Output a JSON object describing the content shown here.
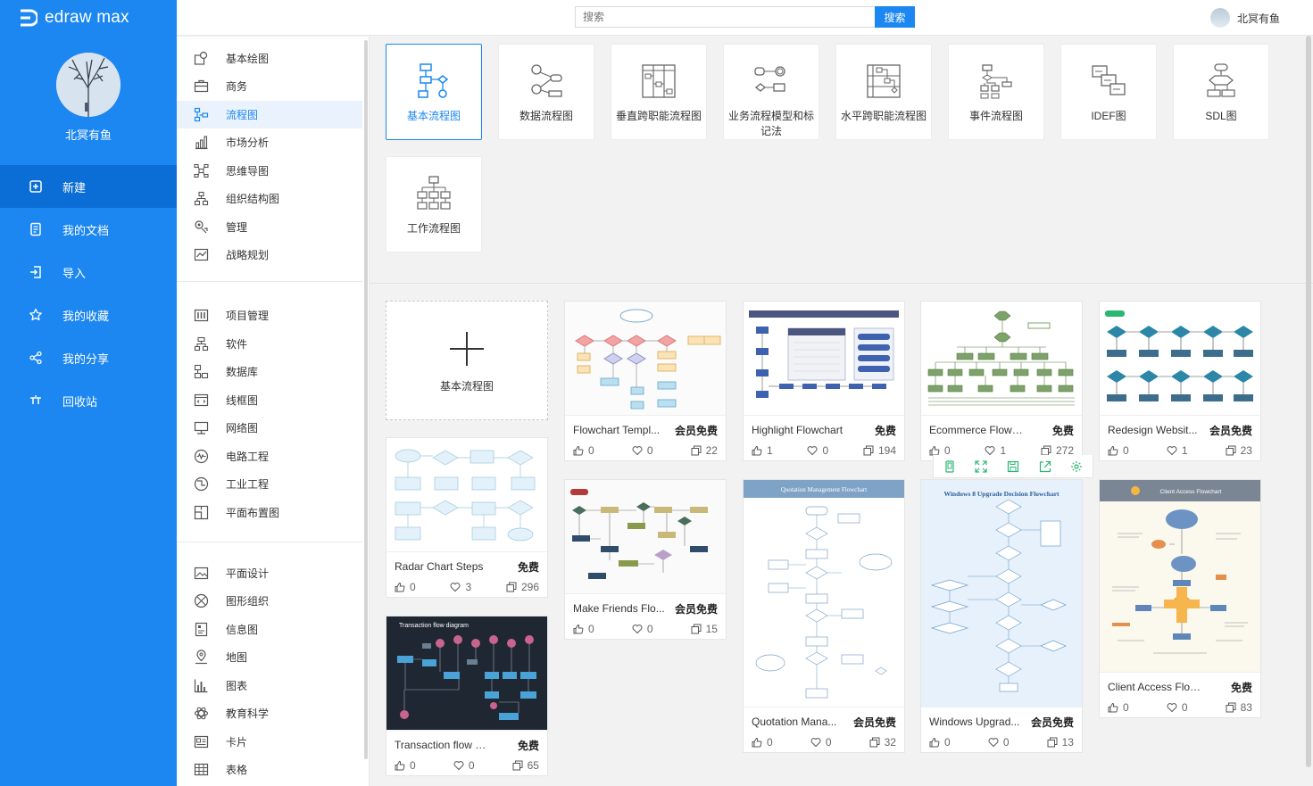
{
  "app": {
    "logo_text": "edraw max"
  },
  "user": {
    "name": "北冥有鱼"
  },
  "nav": [
    {
      "label": "新建",
      "icon": "new-file-icon",
      "active": true
    },
    {
      "label": "我的文档",
      "icon": "documents-icon"
    },
    {
      "label": "导入",
      "icon": "import-icon"
    },
    {
      "label": "我的收藏",
      "icon": "star-icon"
    },
    {
      "label": "我的分享",
      "icon": "share-icon"
    },
    {
      "label": "回收站",
      "icon": "trash-icon"
    }
  ],
  "search": {
    "placeholder": "搜索",
    "button": "搜索"
  },
  "categories": [
    [
      "基本绘图",
      "商务",
      "流程图",
      "市场分析",
      "思维导图",
      "组织结构图",
      "管理",
      "战略规划"
    ],
    [
      "项目管理",
      "软件",
      "数据库",
      "线框图",
      "网络图",
      "电路工程",
      "工业工程",
      "平面布置图"
    ],
    [
      "平面设计",
      "图形组织",
      "信息图",
      "地图",
      "图表",
      "教育科学",
      "卡片",
      "表格"
    ]
  ],
  "active_category": "流程图",
  "types": [
    {
      "label": "基本流程图",
      "active": true
    },
    {
      "label": "数据流程图"
    },
    {
      "label": "垂直跨职能流程图"
    },
    {
      "label": "业务流程模型和标记法"
    },
    {
      "label": "水平跨职能流程图"
    },
    {
      "label": "事件流程图"
    },
    {
      "label": "IDEF图"
    },
    {
      "label": "SDL图"
    },
    {
      "label": "工作流程图"
    }
  ],
  "new_card": {
    "label": "基本流程图"
  },
  "templates": [
    {
      "title": "Flowchart Templ...",
      "badge": "会员免费",
      "likes": "0",
      "favs": "0",
      "copies": "22"
    },
    {
      "title": "Highlight Flowchart",
      "badge": "免费",
      "likes": "1",
      "favs": "0",
      "copies": "194"
    },
    {
      "title": "Ecommerce Flowcha...",
      "badge": "免费",
      "likes": "0",
      "favs": "1",
      "copies": "272"
    },
    {
      "title": "Redesign Websit...",
      "badge": "会员免费",
      "likes": "0",
      "favs": "1",
      "copies": "23"
    },
    {
      "title": "Radar Chart Steps",
      "badge": "免费",
      "likes": "0",
      "favs": "3",
      "copies": "296"
    },
    {
      "title": "Make Friends Flo...",
      "badge": "会员免费",
      "likes": "0",
      "favs": "0",
      "copies": "15"
    },
    {
      "title": "Quotation Mana...",
      "badge": "会员免费",
      "likes": "0",
      "favs": "0",
      "copies": "32",
      "thumb_title": "Quotation Management Flowchart"
    },
    {
      "title": "Windows Upgrad...",
      "badge": "会员免费",
      "likes": "0",
      "favs": "0",
      "copies": "13",
      "thumb_title": "Windows 8 Upgrade Decision Flowchart"
    },
    {
      "title": "Client Access Flowch...",
      "badge": "免费",
      "likes": "0",
      "favs": "0",
      "copies": "83",
      "thumb_title": "Client Access Flowchart"
    },
    {
      "title": "Transaction flow diag...",
      "badge": "免费",
      "likes": "0",
      "favs": "0",
      "copies": "65",
      "thumb_title": "Transaction flow diagram"
    }
  ],
  "hover_tools": [
    "phone-icon",
    "expand-icon",
    "save-icon",
    "share-icon",
    "settings-icon"
  ],
  "colors": {
    "brand": "#1c87f0",
    "nav_active": "#0b6ed6"
  }
}
